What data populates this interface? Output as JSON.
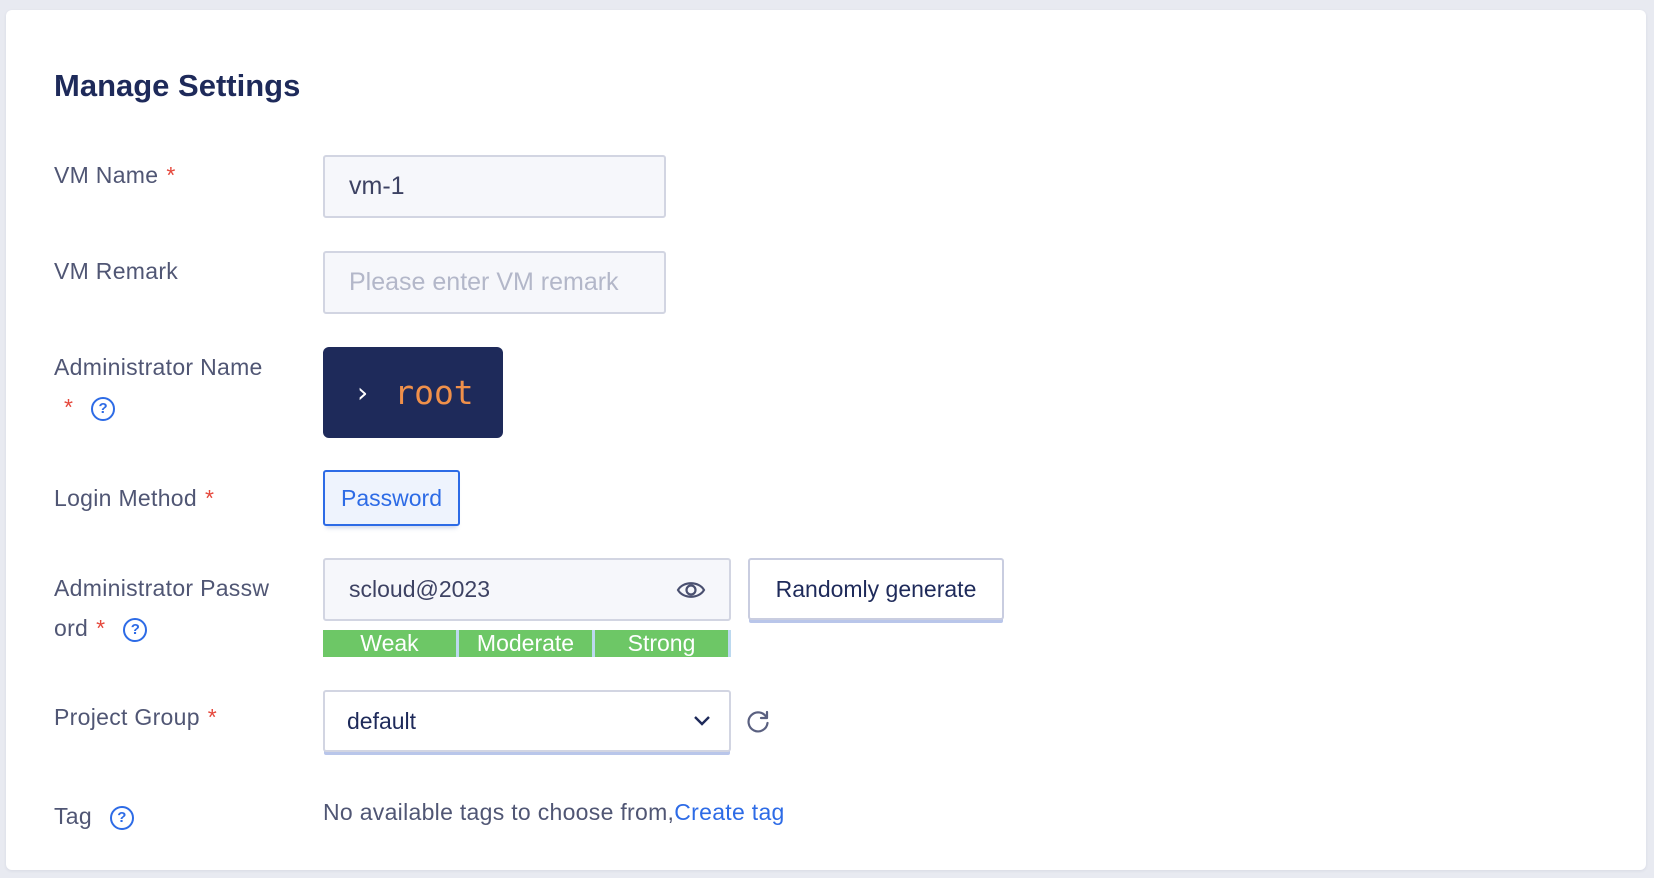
{
  "page": {
    "title": "Manage Settings"
  },
  "form": {
    "required_mark": "*",
    "help_glyph": "?",
    "vm_name": {
      "label": "VM Name",
      "value": "vm-1"
    },
    "vm_remark": {
      "label": "VM Remark",
      "placeholder": "Please enter VM remark"
    },
    "admin_name": {
      "label": "Administrator Name",
      "chevron": "›",
      "value": "root"
    },
    "login_method": {
      "label": "Login Method",
      "selected": "Password"
    },
    "admin_password": {
      "label_line1": "Administrator Passw",
      "label_line2": "ord",
      "value": "scloud@2023",
      "random_button": "Randomly generate",
      "strength_levels": [
        "Weak",
        "Moderate",
        "Strong"
      ],
      "strength_color": "#6dc766"
    },
    "project_group": {
      "label": "Project Group",
      "selected": "default"
    },
    "tag": {
      "label": "Tag",
      "message": "No available tags to choose from,",
      "link": "Create tag"
    }
  },
  "colors": {
    "accent": "#2d6be6",
    "title": "#1e2a5a",
    "required": "#e5483c",
    "admin_bg": "#1e2a5a",
    "admin_text": "#f0904a"
  }
}
